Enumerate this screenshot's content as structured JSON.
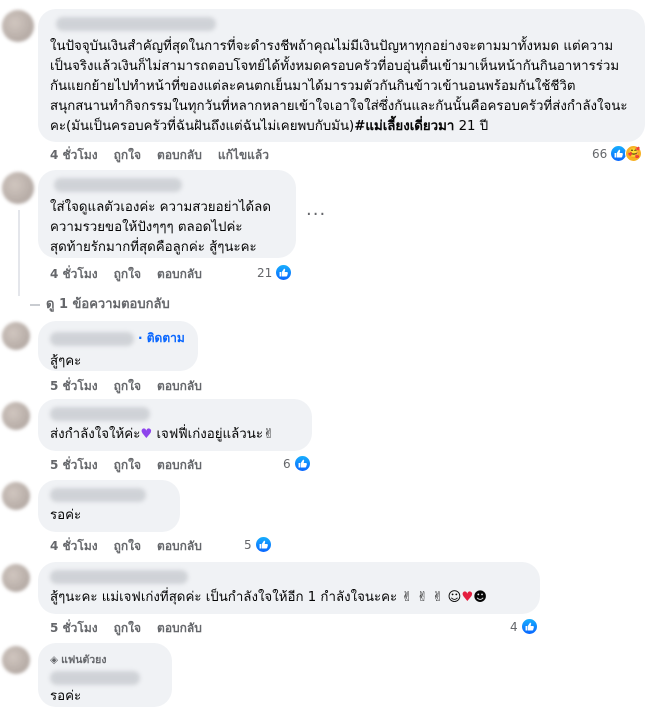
{
  "comments": [
    {
      "text": "ในปัจจุบันเงินสำคัญที่สุดในการที่จะดำรงชีพถ้าคุณไม่มีเงินปัญหาทุกอย่างจะตามมาทั้งหมด แต่ความเป็นจริงแล้วเงินก็ไม่สามารถตอบโจทย์ได้ทั้งหมดครอบครัวที่อบอุ่นตื่นเข้ามาเห็นหน้ากันกินอาหารร่วมกันแยกย้ายไปทำหน้าที่ของแต่ละคนตกเย็นมาได้มารวมตัวกันกินข้าวเข้านอนพร้อมกันใช้ชีวิตสนุกสนานทำกิจกรรมในทุกวันที่หลากหลายเข้าใจเอาใจใส่ซึ่งกันและกันนั้นคือครอบครัวที่ส่งกำลังใจนะคะ(มันเป็นครอบครัวที่ฉันฝันถึงแต่ฉันไม่เคยพบกับมัน)",
      "hashtag": "#แม่เลี้ยงเดี่ยวมา",
      "suffix": " 21 ปี",
      "time": "4 ชั่วโมง",
      "like": "ถูกใจ",
      "reply": "ตอบกลับ",
      "edited": "แก้ไขแล้ว",
      "reactions": "66"
    },
    {
      "text": "ใส่ใจดูแลตัวเองค่ะ ความสวยอย่าได้ลด\nความรวยขอให้ปังๆๆๆ ตลอดไปค่ะ\nสุดท้ายรักมากที่สุดคือลูกค่ะ สู้ๆนะคะ",
      "time": "4 ชั่วโมง",
      "like": "ถูกใจ",
      "reply": "ตอบกลับ",
      "reactions": "21",
      "more": "···"
    }
  ],
  "view_replies": "ดู 1 ข้อความตอบกลับ",
  "follow_label": "· ติดตาม",
  "replies": [
    {
      "text": "สู้ๆคะ",
      "time": "5 ชั่วโมง",
      "like": "ถูกใจ",
      "reply": "ตอบกลับ",
      "reactions": ""
    },
    {
      "text": "ส่งกำลังใจให้ค่ะ",
      "text2": " เจฟฟี่เก่งอยู่แล้วนะ",
      "time": "5 ชั่วโมง",
      "like": "ถูกใจ",
      "reply": "ตอบกลับ",
      "reactions": "6"
    },
    {
      "text": "รอค่ะ",
      "time": "4 ชั่วโมง",
      "like": "ถูกใจ",
      "reply": "ตอบกลับ",
      "reactions": "5"
    },
    {
      "text": "สู้ๆนะคะ แม่เจฟเก่งที่สุดค่ะ เป็นกำลังใจให้อีก 1 กำลังใจนะคะ",
      "time": "5 ชั่วโมง",
      "like": "ถูกใจ",
      "reply": "ตอบกลับ",
      "reactions": "4"
    },
    {
      "text": "รอค่ะ",
      "fan_badge": "แฟนตัวยง"
    }
  ],
  "colors": {
    "bubble": "#f0f2f5",
    "link": "#0866ff",
    "meta": "#65676b"
  }
}
